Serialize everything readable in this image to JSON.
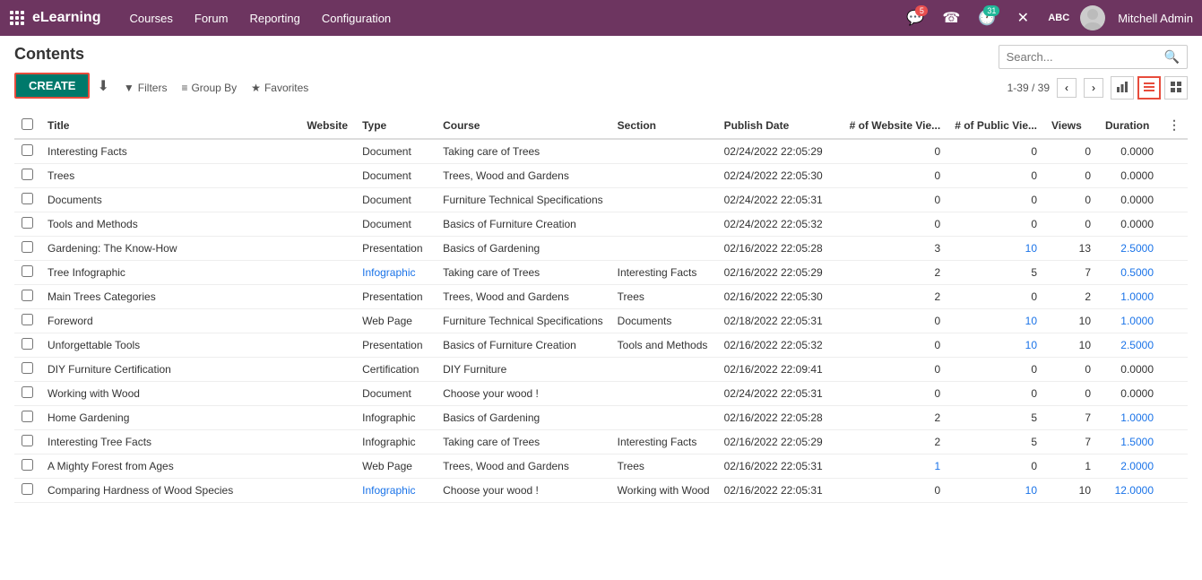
{
  "app": {
    "name": "eLearning",
    "nav_items": [
      "Courses",
      "Forum",
      "Reporting",
      "Configuration"
    ]
  },
  "topnav_icons": {
    "chat_badge": "5",
    "phone_label": "☎",
    "clock_badge": "31",
    "tools_label": "✕",
    "abc_label": "ABC",
    "user_name": "Mitchell Admin"
  },
  "page": {
    "title": "Contents"
  },
  "toolbar": {
    "create_label": "CREATE",
    "download_label": "⬇"
  },
  "search": {
    "placeholder": "Search..."
  },
  "filter_bar": {
    "filters_label": "Filters",
    "groupby_label": "Group By",
    "favorites_label": "Favorites",
    "pagination": "1-39 / 39"
  },
  "views": {
    "bar_chart": "📊",
    "list": "☰",
    "grid": "⊞"
  },
  "table": {
    "headers": [
      "Title",
      "Website",
      "Type",
      "Course",
      "Section",
      "Publish Date",
      "# of Website Vie...",
      "# of Public Vie...",
      "Views",
      "Duration"
    ],
    "rows": [
      {
        "title": "Interesting Facts",
        "title_link": false,
        "website": "",
        "type": "Document",
        "type_link": false,
        "course": "Taking care of Trees",
        "course_link": true,
        "section": "",
        "publish_date": "02/24/2022 22:05:29",
        "website_views": "0",
        "website_views_link": false,
        "public_views": "0",
        "public_views_link": false,
        "views": "0",
        "duration": "0.0000"
      },
      {
        "title": "Trees",
        "title_link": false,
        "website": "",
        "type": "Document",
        "type_link": false,
        "course": "Trees, Wood and Gardens",
        "course_link": true,
        "section": "",
        "publish_date": "02/24/2022 22:05:30",
        "website_views": "0",
        "website_views_link": false,
        "public_views": "0",
        "public_views_link": false,
        "views": "0",
        "duration": "0.0000"
      },
      {
        "title": "Documents",
        "title_link": false,
        "website": "",
        "type": "Document",
        "type_link": false,
        "course": "Furniture Technical Specifications",
        "course_link": true,
        "section": "",
        "publish_date": "02/24/2022 22:05:31",
        "website_views": "0",
        "website_views_link": false,
        "public_views": "0",
        "public_views_link": false,
        "views": "0",
        "duration": "0.0000"
      },
      {
        "title": "Tools and Methods",
        "title_link": false,
        "website": "",
        "type": "Document",
        "type_link": false,
        "course": "Basics of Furniture Creation",
        "course_link": true,
        "section": "",
        "publish_date": "02/24/2022 22:05:32",
        "website_views": "0",
        "website_views_link": false,
        "public_views": "0",
        "public_views_link": false,
        "views": "0",
        "duration": "0.0000"
      },
      {
        "title": "Gardening: The Know-How",
        "title_link": false,
        "website": "",
        "type": "Presentation",
        "type_link": false,
        "course": "Basics of Gardening",
        "course_link": true,
        "section": "",
        "publish_date": "02/16/2022 22:05:28",
        "website_views": "3",
        "website_views_link": false,
        "public_views": "10",
        "public_views_link": true,
        "views": "13",
        "duration": "2.5000"
      },
      {
        "title": "Tree Infographic",
        "title_link": false,
        "website": "",
        "type": "Infographic",
        "type_link": true,
        "course": "Taking care of Trees",
        "course_link": true,
        "section": "Interesting Facts",
        "publish_date": "02/16/2022 22:05:29",
        "website_views": "2",
        "website_views_link": false,
        "public_views": "5",
        "public_views_link": false,
        "views": "7",
        "duration": "0.5000"
      },
      {
        "title": "Main Trees Categories",
        "title_link": false,
        "website": "",
        "type": "Presentation",
        "type_link": false,
        "course": "Trees, Wood and Gardens",
        "course_link": true,
        "section": "Trees",
        "publish_date": "02/16/2022 22:05:30",
        "website_views": "2",
        "website_views_link": false,
        "public_views": "0",
        "public_views_link": false,
        "views": "2",
        "duration": "1.0000"
      },
      {
        "title": "Foreword",
        "title_link": false,
        "website": "",
        "type": "Web Page",
        "type_link": false,
        "course": "Furniture Technical Specifications",
        "course_link": true,
        "section": "Documents",
        "publish_date": "02/18/2022 22:05:31",
        "website_views": "0",
        "website_views_link": false,
        "public_views": "10",
        "public_views_link": true,
        "views": "10",
        "duration": "1.0000"
      },
      {
        "title": "Unforgettable Tools",
        "title_link": false,
        "website": "",
        "type": "Presentation",
        "type_link": false,
        "course": "Basics of Furniture Creation",
        "course_link": true,
        "section": "Tools and Methods",
        "publish_date": "02/16/2022 22:05:32",
        "website_views": "0",
        "website_views_link": false,
        "public_views": "10",
        "public_views_link": true,
        "views": "10",
        "duration": "2.5000"
      },
      {
        "title": "DIY Furniture Certification",
        "title_link": false,
        "website": "",
        "type": "Certification",
        "type_link": false,
        "course": "DIY Furniture",
        "course_link": true,
        "section": "",
        "publish_date": "02/16/2022 22:09:41",
        "website_views": "0",
        "website_views_link": false,
        "public_views": "0",
        "public_views_link": false,
        "views": "0",
        "duration": "0.0000"
      },
      {
        "title": "Working with Wood",
        "title_link": false,
        "website": "",
        "type": "Document",
        "type_link": false,
        "course": "Choose your wood !",
        "course_link": true,
        "section": "",
        "publish_date": "02/24/2022 22:05:31",
        "website_views": "0",
        "website_views_link": false,
        "public_views": "0",
        "public_views_link": false,
        "views": "0",
        "duration": "0.0000"
      },
      {
        "title": "Home Gardening",
        "title_link": false,
        "website": "",
        "type": "Infographic",
        "type_link": false,
        "course": "Basics of Gardening",
        "course_link": true,
        "section": "",
        "publish_date": "02/16/2022 22:05:28",
        "website_views": "2",
        "website_views_link": false,
        "public_views": "5",
        "public_views_link": false,
        "views": "7",
        "duration": "1.0000"
      },
      {
        "title": "Interesting Tree Facts",
        "title_link": false,
        "website": "",
        "type": "Infographic",
        "type_link": false,
        "course": "Taking care of Trees",
        "course_link": true,
        "section": "Interesting Facts",
        "publish_date": "02/16/2022 22:05:29",
        "website_views": "2",
        "website_views_link": false,
        "public_views": "5",
        "public_views_link": false,
        "views": "7",
        "duration": "1.5000"
      },
      {
        "title": "A Mighty Forest from Ages",
        "title_link": false,
        "website": "",
        "type": "Web Page",
        "type_link": false,
        "course": "Trees, Wood and Gardens",
        "course_link": true,
        "section": "Trees",
        "publish_date": "02/16/2022 22:05:31",
        "website_views": "1",
        "website_views_link": true,
        "public_views": "0",
        "public_views_link": false,
        "views": "1",
        "duration": "2.0000"
      },
      {
        "title": "Comparing Hardness of Wood Species",
        "title_link": false,
        "website": "",
        "type": "Infographic",
        "type_link": true,
        "course": "Choose your wood !",
        "course_link": true,
        "section": "Working with Wood",
        "publish_date": "02/16/2022 22:05:31",
        "website_views": "0",
        "website_views_link": false,
        "public_views": "10",
        "public_views_link": true,
        "views": "10",
        "duration": "12.0000"
      }
    ]
  }
}
